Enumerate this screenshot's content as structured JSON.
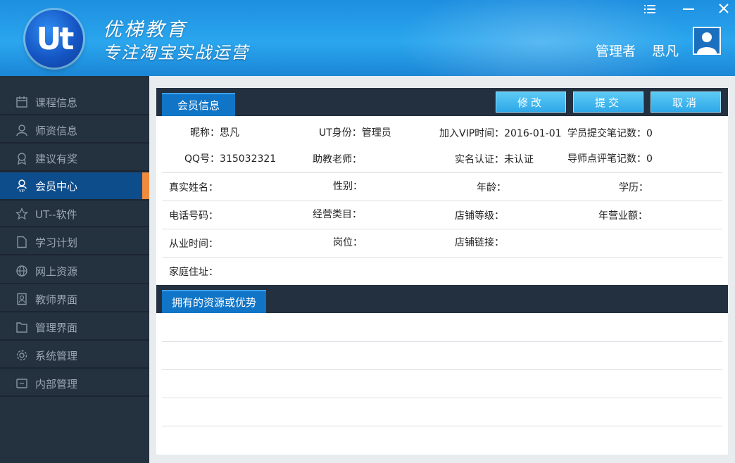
{
  "header": {
    "brand_name": "优梯教育",
    "brand_slogan": "专注淘宝实战运营",
    "logo_text": "Ut",
    "user_role": "管理者",
    "user_name": "思凡",
    "controls": [
      "menu-icon",
      "minimize-icon",
      "close-icon"
    ]
  },
  "sidebar": {
    "items": [
      {
        "label": "课程信息",
        "icon": "calendar-icon"
      },
      {
        "label": "师资信息",
        "icon": "teacher-icon"
      },
      {
        "label": "建议有奖",
        "icon": "award-icon"
      },
      {
        "label": "会员中心",
        "icon": "vip-user-icon",
        "active": true
      },
      {
        "label": "UT--软件",
        "icon": "star-icon"
      },
      {
        "label": "学习计划",
        "icon": "document-icon"
      },
      {
        "label": "网上资源",
        "icon": "globe-icon"
      },
      {
        "label": "教师界面",
        "icon": "contact-icon"
      },
      {
        "label": "管理界面",
        "icon": "folder-icon"
      },
      {
        "label": "系统管理",
        "icon": "gear-icon"
      },
      {
        "label": "内部管理",
        "icon": "inbox-icon"
      }
    ]
  },
  "member_panel": {
    "tab_label": "会员信息",
    "buttons": {
      "edit": "修改",
      "submit": "提交",
      "cancel": "取消"
    },
    "fields": {
      "nickname": "昵称：思凡",
      "ut_identity": "UT身份：管理员",
      "vip_join_time": "加入VIP时间：2016-01-01",
      "student_notes": "学员提交笔记数：0",
      "qq": "QQ号：315032321",
      "assistant_teacher": "助教老师：",
      "real_name_verified": "实名认证：未认证",
      "mentor_notes": "导师点评笔记数：0",
      "real_name": "真实姓名：",
      "gender": "性别：",
      "age": "年龄：",
      "education": "学历：",
      "phone": "电话号码：",
      "business_category": "经营类目：",
      "shop_level": "店铺等级：",
      "annual_revenue": "年营业额：",
      "work_time": "从业时间：",
      "position": "岗位：",
      "shop_link": "店铺链接：",
      "home_address": "家庭住址："
    }
  },
  "resources_panel": {
    "tab_label": "拥有的资源或优势"
  },
  "colors": {
    "header_blue": "#2aa6ee",
    "sidebar_bg": "#24313f",
    "active_item": "#0d4d8c",
    "active_accent": "#f08a3c",
    "tab_blue": "#1175c7",
    "button_cyan": "#3ab4ec"
  }
}
